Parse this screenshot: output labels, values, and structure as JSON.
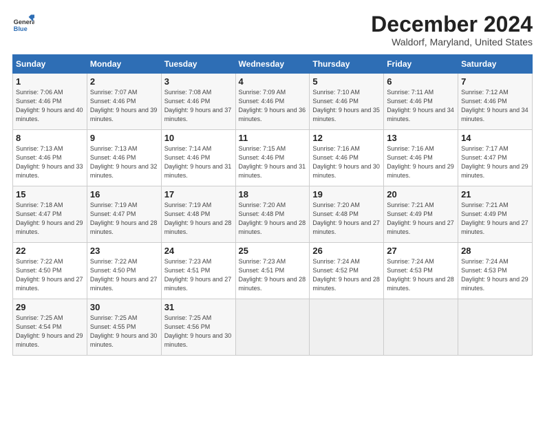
{
  "header": {
    "logo_line1": "General",
    "logo_line2": "Blue",
    "month": "December 2024",
    "location": "Waldorf, Maryland, United States"
  },
  "days_of_week": [
    "Sunday",
    "Monday",
    "Tuesday",
    "Wednesday",
    "Thursday",
    "Friday",
    "Saturday"
  ],
  "weeks": [
    [
      {
        "day": "1",
        "sunrise": "Sunrise: 7:06 AM",
        "sunset": "Sunset: 4:46 PM",
        "daylight": "Daylight: 9 hours and 40 minutes."
      },
      {
        "day": "2",
        "sunrise": "Sunrise: 7:07 AM",
        "sunset": "Sunset: 4:46 PM",
        "daylight": "Daylight: 9 hours and 39 minutes."
      },
      {
        "day": "3",
        "sunrise": "Sunrise: 7:08 AM",
        "sunset": "Sunset: 4:46 PM",
        "daylight": "Daylight: 9 hours and 37 minutes."
      },
      {
        "day": "4",
        "sunrise": "Sunrise: 7:09 AM",
        "sunset": "Sunset: 4:46 PM",
        "daylight": "Daylight: 9 hours and 36 minutes."
      },
      {
        "day": "5",
        "sunrise": "Sunrise: 7:10 AM",
        "sunset": "Sunset: 4:46 PM",
        "daylight": "Daylight: 9 hours and 35 minutes."
      },
      {
        "day": "6",
        "sunrise": "Sunrise: 7:11 AM",
        "sunset": "Sunset: 4:46 PM",
        "daylight": "Daylight: 9 hours and 34 minutes."
      },
      {
        "day": "7",
        "sunrise": "Sunrise: 7:12 AM",
        "sunset": "Sunset: 4:46 PM",
        "daylight": "Daylight: 9 hours and 34 minutes."
      }
    ],
    [
      {
        "day": "8",
        "sunrise": "Sunrise: 7:13 AM",
        "sunset": "Sunset: 4:46 PM",
        "daylight": "Daylight: 9 hours and 33 minutes."
      },
      {
        "day": "9",
        "sunrise": "Sunrise: 7:13 AM",
        "sunset": "Sunset: 4:46 PM",
        "daylight": "Daylight: 9 hours and 32 minutes."
      },
      {
        "day": "10",
        "sunrise": "Sunrise: 7:14 AM",
        "sunset": "Sunset: 4:46 PM",
        "daylight": "Daylight: 9 hours and 31 minutes."
      },
      {
        "day": "11",
        "sunrise": "Sunrise: 7:15 AM",
        "sunset": "Sunset: 4:46 PM",
        "daylight": "Daylight: 9 hours and 31 minutes."
      },
      {
        "day": "12",
        "sunrise": "Sunrise: 7:16 AM",
        "sunset": "Sunset: 4:46 PM",
        "daylight": "Daylight: 9 hours and 30 minutes."
      },
      {
        "day": "13",
        "sunrise": "Sunrise: 7:16 AM",
        "sunset": "Sunset: 4:46 PM",
        "daylight": "Daylight: 9 hours and 29 minutes."
      },
      {
        "day": "14",
        "sunrise": "Sunrise: 7:17 AM",
        "sunset": "Sunset: 4:47 PM",
        "daylight": "Daylight: 9 hours and 29 minutes."
      }
    ],
    [
      {
        "day": "15",
        "sunrise": "Sunrise: 7:18 AM",
        "sunset": "Sunset: 4:47 PM",
        "daylight": "Daylight: 9 hours and 29 minutes."
      },
      {
        "day": "16",
        "sunrise": "Sunrise: 7:19 AM",
        "sunset": "Sunset: 4:47 PM",
        "daylight": "Daylight: 9 hours and 28 minutes."
      },
      {
        "day": "17",
        "sunrise": "Sunrise: 7:19 AM",
        "sunset": "Sunset: 4:48 PM",
        "daylight": "Daylight: 9 hours and 28 minutes."
      },
      {
        "day": "18",
        "sunrise": "Sunrise: 7:20 AM",
        "sunset": "Sunset: 4:48 PM",
        "daylight": "Daylight: 9 hours and 28 minutes."
      },
      {
        "day": "19",
        "sunrise": "Sunrise: 7:20 AM",
        "sunset": "Sunset: 4:48 PM",
        "daylight": "Daylight: 9 hours and 27 minutes."
      },
      {
        "day": "20",
        "sunrise": "Sunrise: 7:21 AM",
        "sunset": "Sunset: 4:49 PM",
        "daylight": "Daylight: 9 hours and 27 minutes."
      },
      {
        "day": "21",
        "sunrise": "Sunrise: 7:21 AM",
        "sunset": "Sunset: 4:49 PM",
        "daylight": "Daylight: 9 hours and 27 minutes."
      }
    ],
    [
      {
        "day": "22",
        "sunrise": "Sunrise: 7:22 AM",
        "sunset": "Sunset: 4:50 PM",
        "daylight": "Daylight: 9 hours and 27 minutes."
      },
      {
        "day": "23",
        "sunrise": "Sunrise: 7:22 AM",
        "sunset": "Sunset: 4:50 PM",
        "daylight": "Daylight: 9 hours and 27 minutes."
      },
      {
        "day": "24",
        "sunrise": "Sunrise: 7:23 AM",
        "sunset": "Sunset: 4:51 PM",
        "daylight": "Daylight: 9 hours and 27 minutes."
      },
      {
        "day": "25",
        "sunrise": "Sunrise: 7:23 AM",
        "sunset": "Sunset: 4:51 PM",
        "daylight": "Daylight: 9 hours and 28 minutes."
      },
      {
        "day": "26",
        "sunrise": "Sunrise: 7:24 AM",
        "sunset": "Sunset: 4:52 PM",
        "daylight": "Daylight: 9 hours and 28 minutes."
      },
      {
        "day": "27",
        "sunrise": "Sunrise: 7:24 AM",
        "sunset": "Sunset: 4:53 PM",
        "daylight": "Daylight: 9 hours and 28 minutes."
      },
      {
        "day": "28",
        "sunrise": "Sunrise: 7:24 AM",
        "sunset": "Sunset: 4:53 PM",
        "daylight": "Daylight: 9 hours and 29 minutes."
      }
    ],
    [
      {
        "day": "29",
        "sunrise": "Sunrise: 7:25 AM",
        "sunset": "Sunset: 4:54 PM",
        "daylight": "Daylight: 9 hours and 29 minutes."
      },
      {
        "day": "30",
        "sunrise": "Sunrise: 7:25 AM",
        "sunset": "Sunset: 4:55 PM",
        "daylight": "Daylight: 9 hours and 30 minutes."
      },
      {
        "day": "31",
        "sunrise": "Sunrise: 7:25 AM",
        "sunset": "Sunset: 4:56 PM",
        "daylight": "Daylight: 9 hours and 30 minutes."
      },
      null,
      null,
      null,
      null
    ]
  ]
}
